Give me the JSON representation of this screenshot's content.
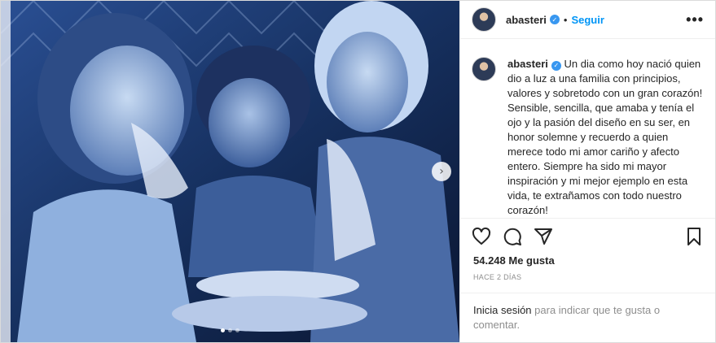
{
  "post": {
    "username": "abasteri",
    "follow_label": "Seguir",
    "separator": "•",
    "more_label": "•••",
    "caption": "Un dia como hoy nació quien dio a luz a una familia con principios, valores y sobretodo con un gran corazón! Sensible, sencilla, que amaba y tenía el ojo y la pasión del diseño en su ser, en honor solemne y recuerdo a quien merece todo mi amor cariño y afecto entero. Siempre ha sido mi mayor inspiración y mi mejor ejemplo en esta vida, te extrañamos con todo nuestro corazón!",
    "likes": "54.248 Me gusta",
    "time_ago": "HACE 2 DÍAS",
    "login_link": "Inicia sesión",
    "login_text": " para indicar que te gusta o comentar."
  },
  "carousel": {
    "current": 1,
    "total": 3,
    "next_glyph": "›"
  },
  "colors": {
    "link": "#0095f6",
    "verified": "#3897f0",
    "photo_tint": "#1c3a7a"
  },
  "icons": [
    "verified-badge-icon",
    "more-options-icon",
    "heart-icon",
    "comment-icon",
    "share-icon",
    "bookmark-icon",
    "next-arrow-icon"
  ]
}
